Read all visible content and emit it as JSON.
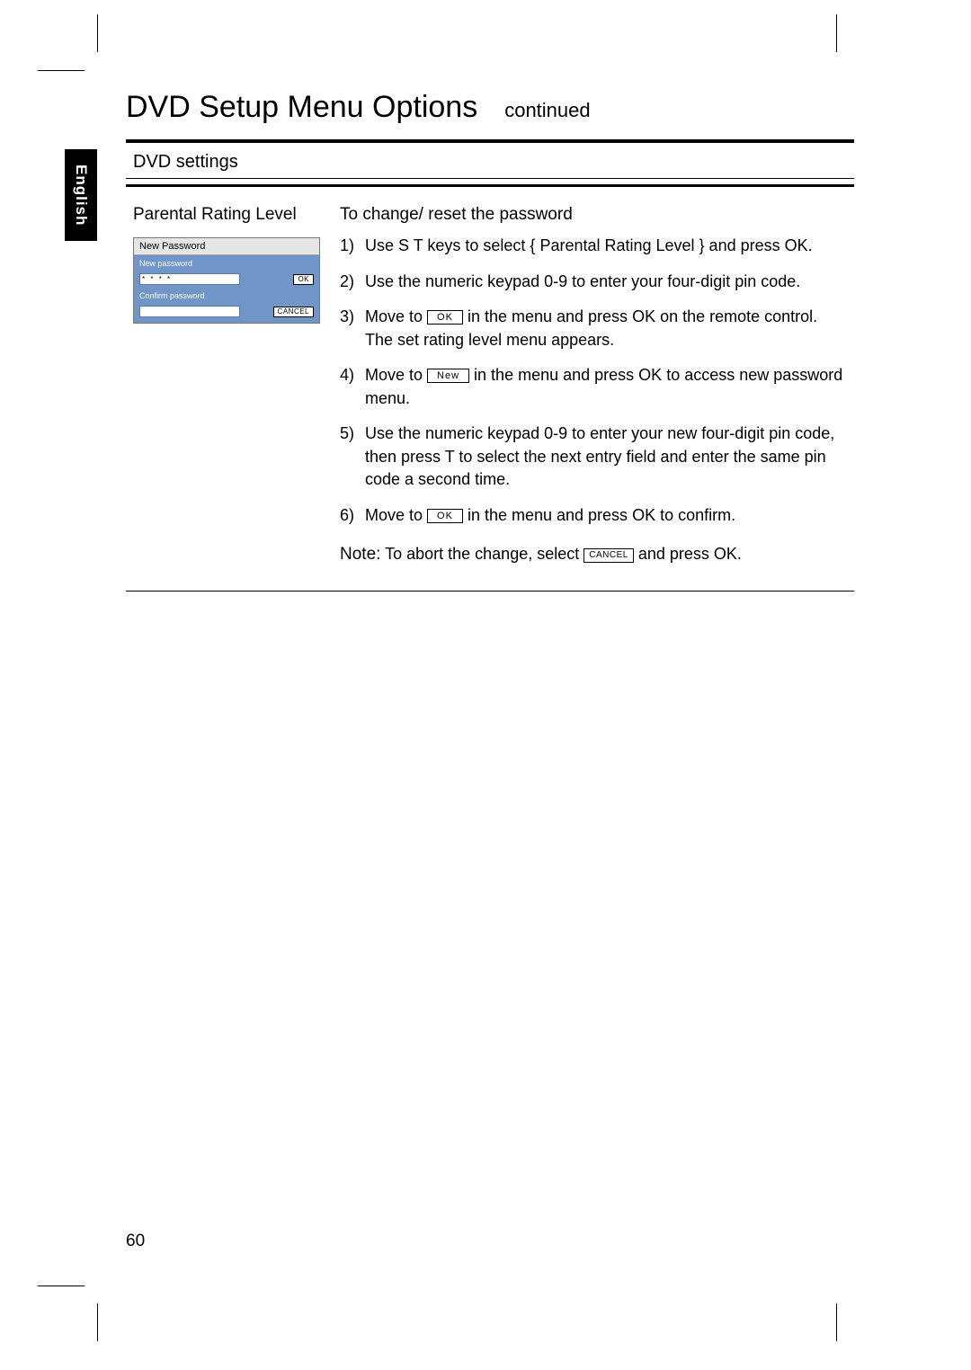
{
  "language_tab": "English",
  "title": "DVD Setup Menu Options",
  "title_suffix": "continued",
  "section_header": "DVD settings",
  "setting_name": "Parental Rating Level",
  "mini": {
    "title": "New Password",
    "label_new": "New password",
    "field_new_value": "* * * *",
    "btn_ok": "OK",
    "label_confirm": "Confirm password",
    "btn_cancel": "CANCEL"
  },
  "instructions_heading": "To change/ reset the password",
  "btn_ok_inline": "OK",
  "btn_new_inline": "New",
  "btn_cancel_inline": "CANCEL",
  "steps": {
    "s1a": "Use ",
    "s1_keys": "S T",
    "s1b": " keys to select { ",
    "s1_opt": "Parental Rating Level",
    "s1c": " } and press ",
    "s1_ok": "OK",
    "s1d": ".",
    "s2a": "Use the ",
    "s2_kbd": "numeric keypad 0-9",
    "s2b": " to enter your four-digit pin code.",
    "s3a": "Move to ",
    "s3b": " in the menu and press ",
    "s3_ok": "OK",
    "s3c": " on the remote control.  The set rating level menu appears.",
    "s4a": "Move to ",
    "s4b": " in the menu and press ",
    "s4_ok": "OK",
    "s4c": " to access new password menu.",
    "s5a": "Use the ",
    "s5_kbd": "numeric keypad 0-9",
    "s5b": " to enter your new four-digit pin code, then press ",
    "s5_key": "T",
    "s5c": " to select the next entry field and enter the same pin code a second time.",
    "s6a": "Move to ",
    "s6b": " in the menu and press ",
    "s6_ok": "OK",
    "s6c": " to confirm."
  },
  "note_label": "Note:",
  "note_a": "  To abort the change, select ",
  "note_b": " and press ",
  "note_ok": "OK",
  "note_c": ".",
  "page_number": "60"
}
